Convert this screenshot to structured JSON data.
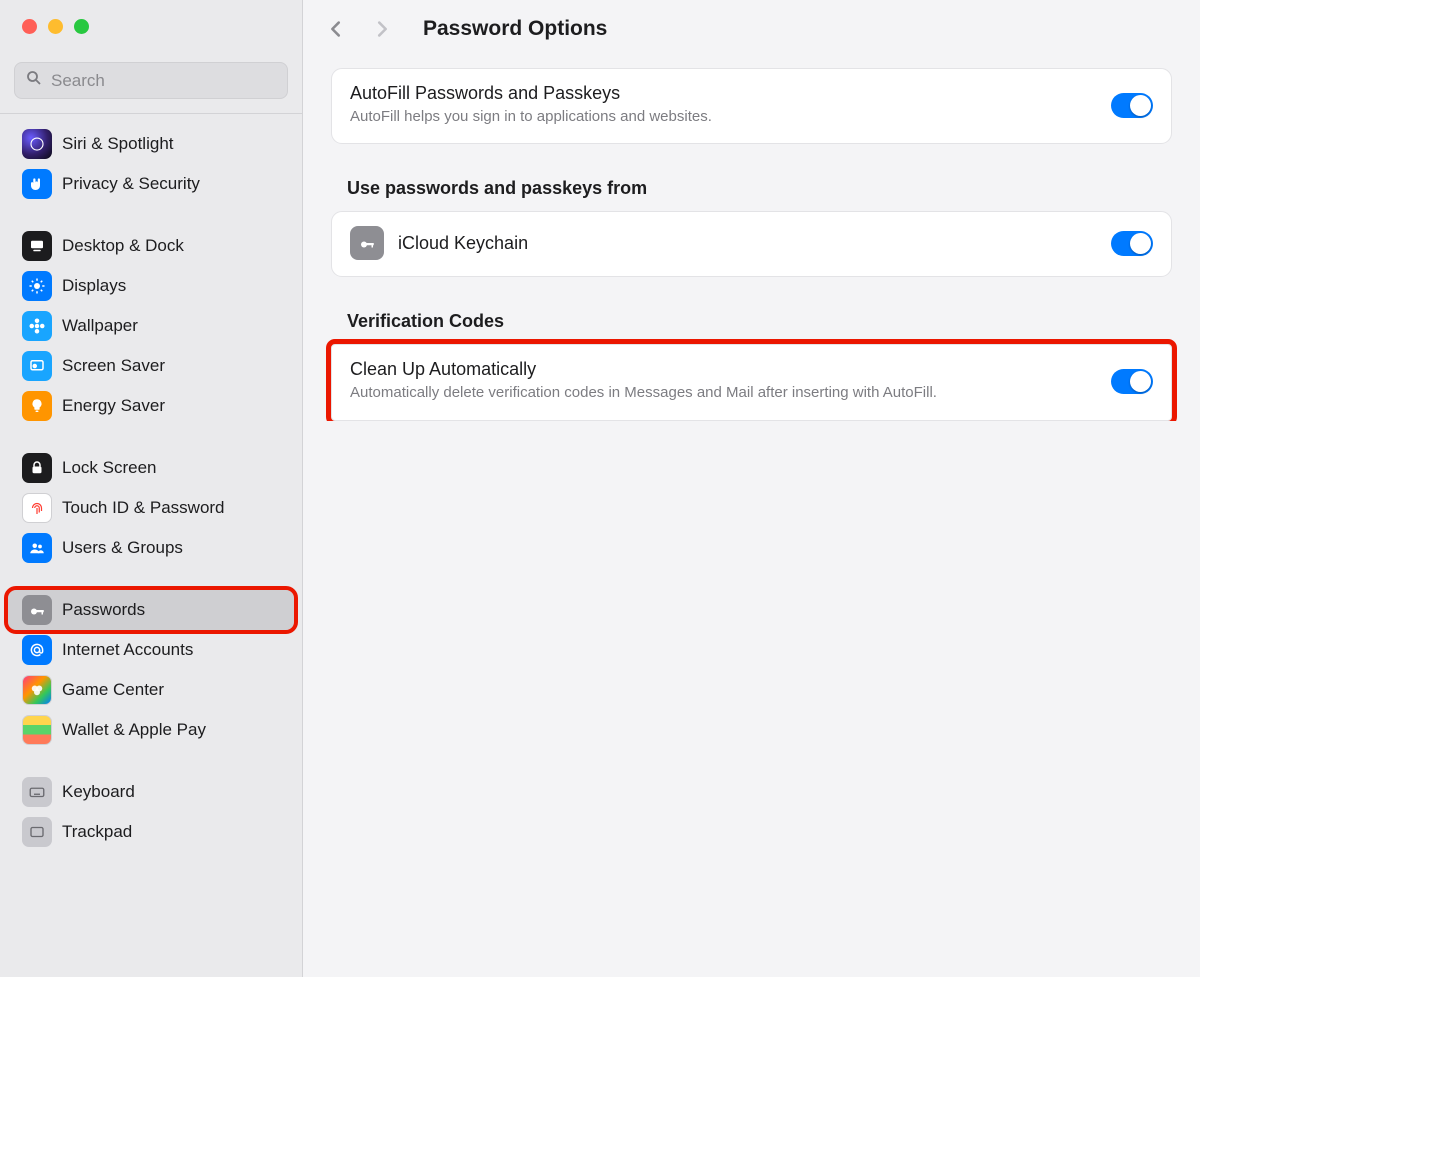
{
  "search": {
    "placeholder": "Search"
  },
  "sidebar": {
    "groups": [
      [
        {
          "label": "Siri & Spotlight"
        },
        {
          "label": "Privacy & Security"
        }
      ],
      [
        {
          "label": "Desktop & Dock"
        },
        {
          "label": "Displays"
        },
        {
          "label": "Wallpaper"
        },
        {
          "label": "Screen Saver"
        },
        {
          "label": "Energy Saver"
        }
      ],
      [
        {
          "label": "Lock Screen"
        },
        {
          "label": "Touch ID & Password"
        },
        {
          "label": "Users & Groups"
        }
      ],
      [
        {
          "label": "Passwords"
        },
        {
          "label": "Internet Accounts"
        },
        {
          "label": "Game Center"
        },
        {
          "label": "Wallet & Apple Pay"
        }
      ],
      [
        {
          "label": "Keyboard"
        },
        {
          "label": "Trackpad"
        }
      ]
    ]
  },
  "main": {
    "title": "Password Options",
    "autofill": {
      "title": "AutoFill Passwords and Passkeys",
      "sub": "AutoFill helps you sign in to applications and websites."
    },
    "useFromHeader": "Use passwords and passkeys from",
    "keychain": {
      "label": "iCloud Keychain"
    },
    "verificationHeader": "Verification Codes",
    "cleanup": {
      "title": "Clean Up Automatically",
      "sub": "Automatically delete verification codes in Messages and Mail after inserting with AutoFill."
    }
  }
}
